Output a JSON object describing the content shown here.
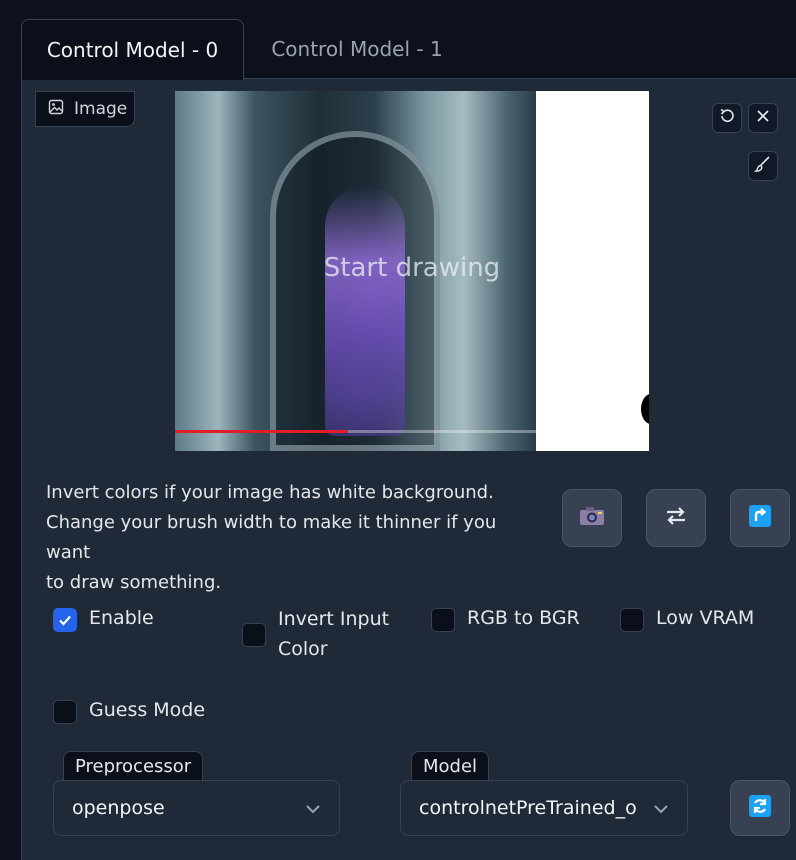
{
  "tabs": [
    {
      "label": "Control Model - 0",
      "active": true
    },
    {
      "label": "Control Model - 1",
      "active": false
    }
  ],
  "image_block": {
    "label": "Image",
    "overlay_text": "Start drawing",
    "video_progress": 0.48,
    "toolbar_icons": [
      "undo-icon",
      "close-icon",
      "brush-icon"
    ]
  },
  "hint_lines": [
    "Invert colors if your image has white background.",
    "Change your brush width to make it thinner if you want",
    "to draw something."
  ],
  "action_buttons": [
    "camera-icon",
    "swap-icon",
    "send-icon"
  ],
  "checkboxes": [
    {
      "label": "Enable",
      "checked": true
    },
    {
      "label": "Invert Input Color",
      "checked": false
    },
    {
      "label": "RGB to BGR",
      "checked": false
    },
    {
      "label": "Low VRAM",
      "checked": false
    },
    {
      "label": "Guess Mode",
      "checked": false
    }
  ],
  "preprocessor": {
    "label": "Preprocessor",
    "value": "openpose"
  },
  "model": {
    "label": "Model",
    "value": "controlnetPreTrained_o"
  },
  "colors": {
    "accent": "#2563eb",
    "panel": "#1f2937",
    "progress": "#e11d2a"
  }
}
